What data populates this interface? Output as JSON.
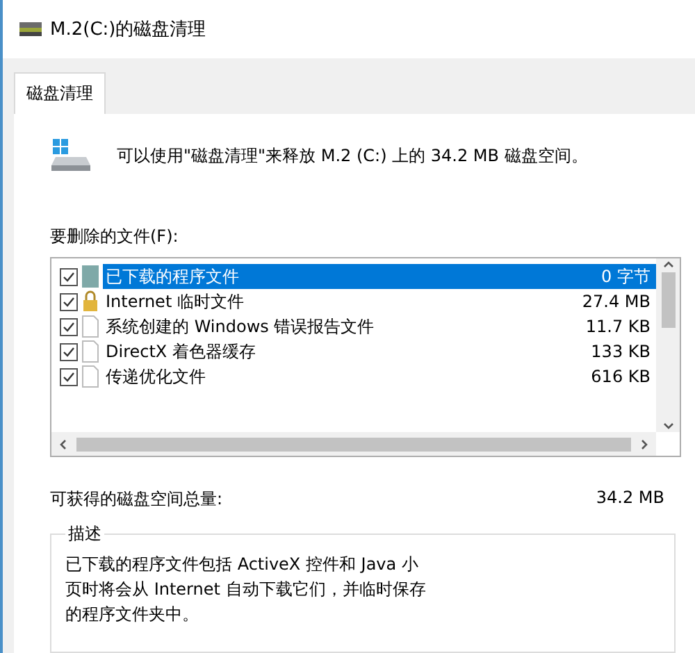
{
  "window": {
    "title": "M.2(C:)的磁盘清理"
  },
  "tabs": [
    {
      "label": "磁盘清理",
      "selected": true
    }
  ],
  "intro": "可以使用\"磁盘清理\"来释放 M.2 (C:) 上的 34.2 MB 磁盘空间。",
  "files_label": "要删除的文件(F):",
  "files": [
    {
      "name": "已下载的程序文件",
      "size": "0 字节",
      "checked": true,
      "selected": true,
      "kind": "folder"
    },
    {
      "name": "Internet 临时文件",
      "size": "27.4 MB",
      "checked": true,
      "selected": false,
      "kind": "lock"
    },
    {
      "name": "系统创建的 Windows 错误报告文件",
      "size": "11.7 KB",
      "checked": true,
      "selected": false,
      "kind": "file"
    },
    {
      "name": "DirectX 着色器缓存",
      "size": "133 KB",
      "checked": true,
      "selected": false,
      "kind": "file"
    },
    {
      "name": "传递优化文件",
      "size": "616 KB",
      "checked": true,
      "selected": false,
      "kind": "file"
    }
  ],
  "total": {
    "label": "可获得的磁盘空间总量:",
    "value": "34.2 MB"
  },
  "description": {
    "title": "描述",
    "lines": [
      "已下载的程序文件包括 ActiveX 控件和 Java 小",
      "页时将会从 Internet 自动下载它们，并临时保存",
      "的程序文件夹中。"
    ]
  }
}
